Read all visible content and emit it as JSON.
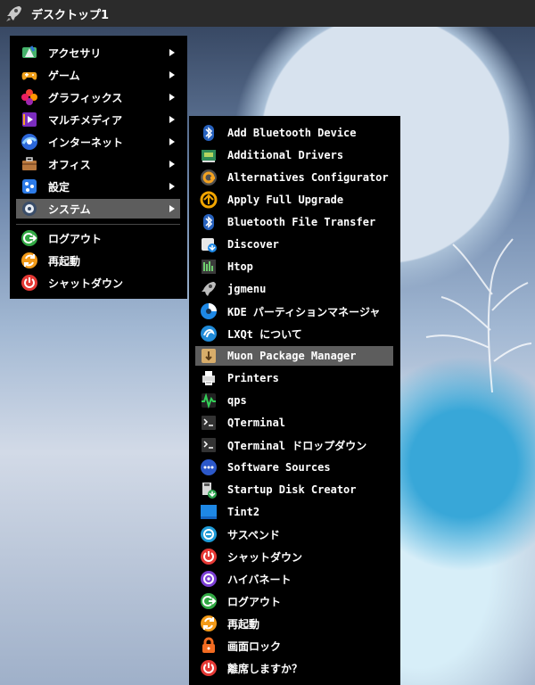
{
  "top_bar": {
    "title": "デスクトップ1",
    "icon": "rocket-icon"
  },
  "main_menu": {
    "items": [
      {
        "label": "アクセサリ",
        "icon": "accessories-icon",
        "has_submenu": true
      },
      {
        "label": "ゲーム",
        "icon": "gamepad-icon",
        "has_submenu": true
      },
      {
        "label": "グラフィックス",
        "icon": "graphics-icon",
        "has_submenu": true
      },
      {
        "label": "マルチメディア",
        "icon": "multimedia-icon",
        "has_submenu": true
      },
      {
        "label": "インターネット",
        "icon": "internet-icon",
        "has_submenu": true
      },
      {
        "label": "オフィス",
        "icon": "office-icon",
        "has_submenu": true
      },
      {
        "label": "設定",
        "icon": "settings-icon",
        "has_submenu": true
      },
      {
        "label": "システム",
        "icon": "system-icon",
        "has_submenu": true,
        "selected": true
      }
    ],
    "session_items": [
      {
        "label": "ログアウト",
        "icon": "logout-icon"
      },
      {
        "label": "再起動",
        "icon": "reboot-icon"
      },
      {
        "label": "シャットダウン",
        "icon": "shutdown-icon"
      }
    ]
  },
  "system_menu": {
    "items": [
      {
        "label": "Add Bluetooth Device",
        "icon": "bluetooth-icon"
      },
      {
        "label": "Additional Drivers",
        "icon": "driver-icon"
      },
      {
        "label": "Alternatives Configurator",
        "icon": "alternatives-icon"
      },
      {
        "label": "Apply Full Upgrade",
        "icon": "upgrade-icon"
      },
      {
        "label": "Bluetooth File Transfer",
        "icon": "bluetooth-icon"
      },
      {
        "label": "Discover",
        "icon": "discover-icon"
      },
      {
        "label": "Htop",
        "icon": "htop-icon"
      },
      {
        "label": "jgmenu",
        "icon": "rocket-icon"
      },
      {
        "label": "KDE パーティションマネージャ",
        "icon": "partition-icon"
      },
      {
        "label": "LXQt について",
        "icon": "lxqt-icon"
      },
      {
        "label": "Muon Package Manager",
        "icon": "package-icon",
        "selected": true
      },
      {
        "label": "Printers",
        "icon": "printer-icon"
      },
      {
        "label": "qps",
        "icon": "process-icon"
      },
      {
        "label": "QTerminal",
        "icon": "terminal-icon"
      },
      {
        "label": "QTerminal ドロップダウン",
        "icon": "terminal-icon"
      },
      {
        "label": "Software Sources",
        "icon": "software-sources-icon"
      },
      {
        "label": "Startup Disk Creator",
        "icon": "usb-disk-icon"
      },
      {
        "label": "Tint2",
        "icon": "tint2-icon"
      },
      {
        "label": "サスペンド",
        "icon": "suspend-icon"
      },
      {
        "label": "シャットダウン",
        "icon": "shutdown-icon"
      },
      {
        "label": "ハイバネート",
        "icon": "hibernate-icon"
      },
      {
        "label": "ログアウト",
        "icon": "logout-icon"
      },
      {
        "label": "再起動",
        "icon": "reboot-icon"
      },
      {
        "label": "画面ロック",
        "icon": "lock-icon"
      },
      {
        "label": "離席しますか？",
        "icon": "away-icon"
      }
    ]
  },
  "colors": {
    "menu_background": "#000000",
    "selection": "#5d5d5d",
    "top_bar": "#2b2b2b"
  }
}
